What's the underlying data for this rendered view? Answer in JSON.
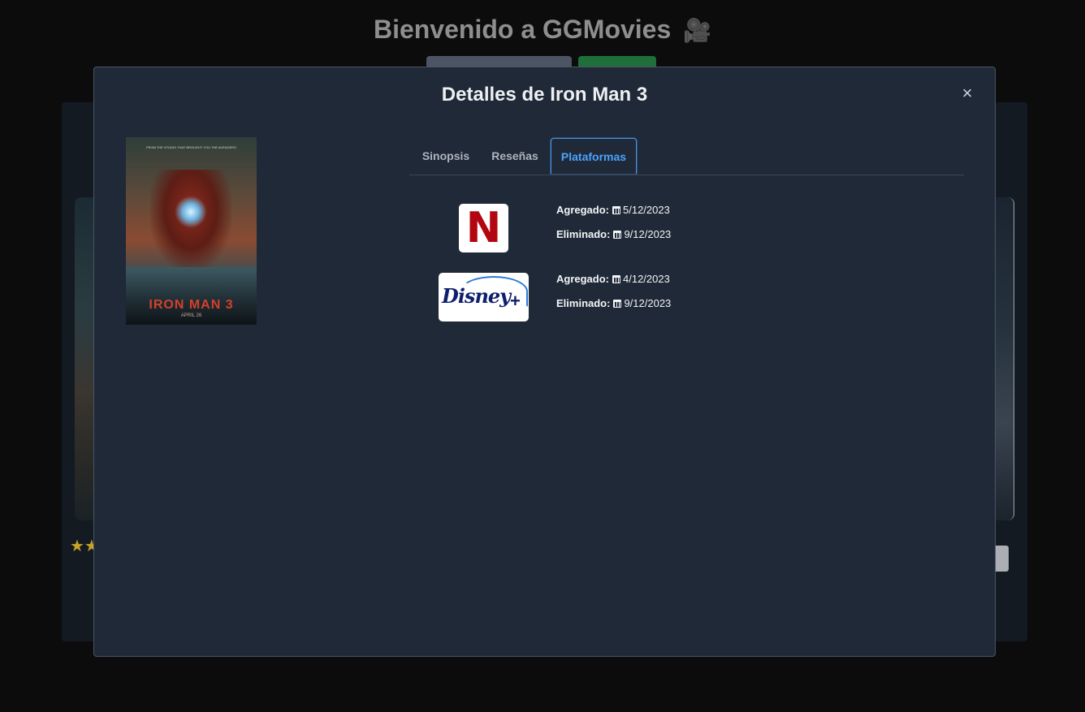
{
  "background": {
    "title": "Bienvenido a GGMovies",
    "title_icon": "movie-camera-icon",
    "stars": "★★"
  },
  "modal": {
    "title": "Detalles de Iron Man 3",
    "close_label": "×",
    "poster": {
      "top_text": "FROM THE STUDIO THAT BROUGHT YOU THE AVENGERS",
      "title": "IRON MAN 3",
      "date": "APRIL 26"
    },
    "tabs": [
      {
        "label": "Sinopsis",
        "active": false
      },
      {
        "label": "Reseñas",
        "active": false
      },
      {
        "label": "Plataformas",
        "active": true
      }
    ],
    "platforms": [
      {
        "name": "Netflix",
        "logo_text": "N",
        "added_label": "Agregado:",
        "added": "5/12/2023",
        "removed_label": "Eliminado:",
        "removed": "9/12/2023"
      },
      {
        "name": "Disney+",
        "logo_text": "Disney",
        "added_label": "Agregado:",
        "added": "4/12/2023",
        "removed_label": "Eliminado:",
        "removed": "9/12/2023"
      }
    ]
  },
  "colors": {
    "modal_bg": "#1f2937",
    "active_tab": "#4aa3ff",
    "netflix_red": "#b20710",
    "disney_blue": "#0f1f6e"
  }
}
